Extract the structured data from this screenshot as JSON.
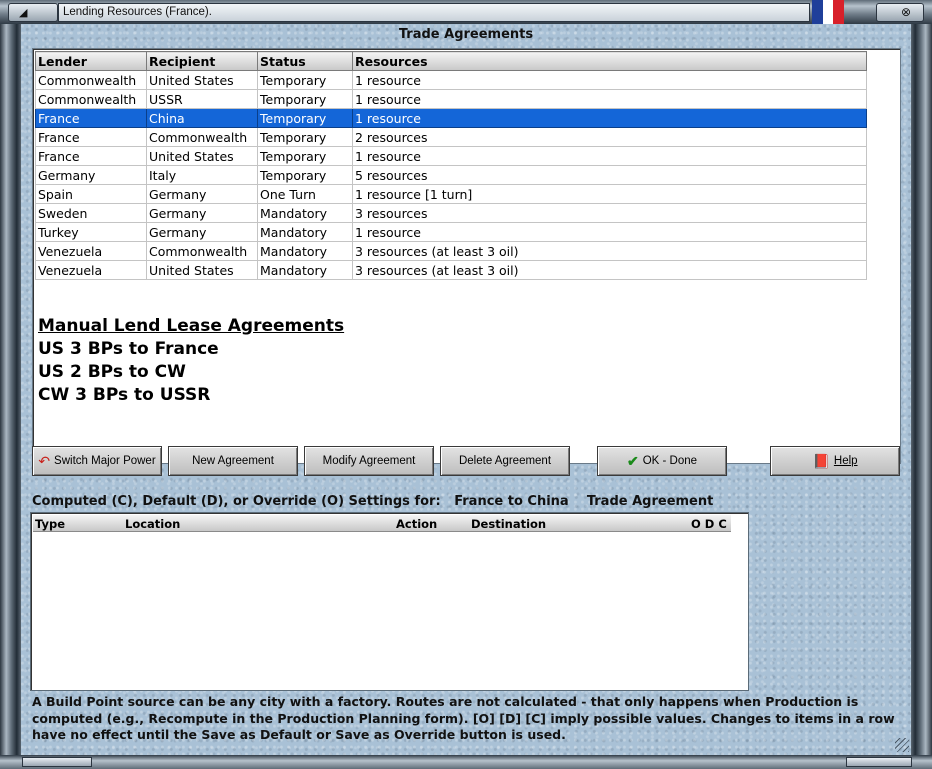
{
  "window": {
    "title": "Lending Resources (France).",
    "flag_colors": [
      "#1f3f9a",
      "#ffffff",
      "#d8202a"
    ]
  },
  "heading": "Trade Agreements",
  "table": {
    "columns": [
      "Lender",
      "Recipient",
      "Status",
      "Resources"
    ],
    "rows": [
      [
        "Commonwealth",
        "United States",
        "Temporary",
        "1 resource"
      ],
      [
        "Commonwealth",
        "USSR",
        "Temporary",
        "1 resource"
      ],
      [
        "France",
        "China",
        "Temporary",
        "1 resource"
      ],
      [
        "France",
        "Commonwealth",
        "Temporary",
        "2 resources"
      ],
      [
        "France",
        "United States",
        "Temporary",
        "1 resource"
      ],
      [
        "Germany",
        "Italy",
        "Temporary",
        "5 resources"
      ],
      [
        "Spain",
        "Germany",
        "One Turn",
        "1 resource [1 turn]"
      ],
      [
        "Sweden",
        "Germany",
        "Mandatory",
        "3 resources"
      ],
      [
        "Turkey",
        "Germany",
        "Mandatory",
        "1 resource"
      ],
      [
        "Venezuela",
        "Commonwealth",
        "Mandatory",
        "3 resources (at least 3 oil)"
      ],
      [
        "Venezuela",
        "United States",
        "Mandatory",
        "3 resources (at least 3 oil)"
      ]
    ],
    "selected_row_index": 2,
    "selected_color": "#1466d8"
  },
  "lend_lease": {
    "title": "Manual Lend Lease Agreements",
    "lines": [
      "US 3 BPs to France",
      "US 2 BPs to CW",
      "CW 3 BPs to USSR"
    ]
  },
  "buttons": {
    "switch_major_power": "Switch Major Power",
    "new_agreement": "New Agreement",
    "modify_agreement": "Modify Agreement",
    "delete_agreement": "Delete Agreement",
    "ok_done": "OK - Done",
    "help": "Help"
  },
  "settings": {
    "label": "Computed (C), Default (D), or Override (O) Settings for:",
    "target": "France to China",
    "kind": "Trade Agreement",
    "columns": {
      "type": "Type",
      "location": "Location",
      "action": "Action",
      "destination": "Destination",
      "odc": "O D C"
    }
  },
  "footer": "A Build Point source can be any city with a factory. Routes are not calculated - that only happens when Production is computed (e.g., Recompute in the Production Planning form).  [O] [D] [C] imply possible values.  Changes to items in a row have no effect until the Save as Default or Save as Override button is used."
}
